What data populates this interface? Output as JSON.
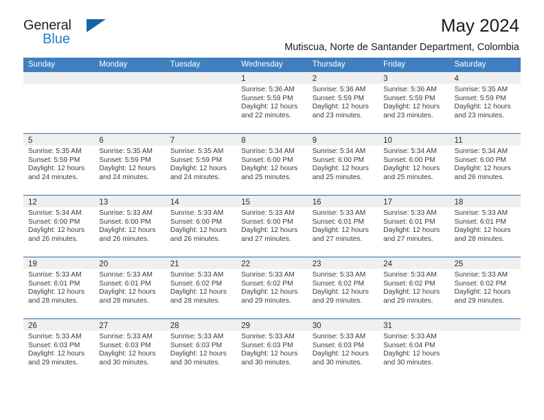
{
  "brand": {
    "name_top": "General",
    "name_bottom": "Blue",
    "accent_color": "#1b7cc2",
    "triangle_color": "#1565a8"
  },
  "header": {
    "title": "May 2024",
    "subtitle": "Mutiscua, Norte de Santander Department, Colombia"
  },
  "calendar": {
    "header_bg": "#3f7fbf",
    "row_divider_color": "#2d6aa8",
    "daynum_band_bg": "#efefef",
    "weekdays": [
      "Sunday",
      "Monday",
      "Tuesday",
      "Wednesday",
      "Thursday",
      "Friday",
      "Saturday"
    ],
    "weeks": [
      [
        {
          "day": "",
          "sunrise": "",
          "sunset": "",
          "daylight_line1": "",
          "daylight_line2": ""
        },
        {
          "day": "",
          "sunrise": "",
          "sunset": "",
          "daylight_line1": "",
          "daylight_line2": ""
        },
        {
          "day": "",
          "sunrise": "",
          "sunset": "",
          "daylight_line1": "",
          "daylight_line2": ""
        },
        {
          "day": "1",
          "sunrise": "Sunrise: 5:36 AM",
          "sunset": "Sunset: 5:59 PM",
          "daylight_line1": "Daylight: 12 hours",
          "daylight_line2": "and 22 minutes."
        },
        {
          "day": "2",
          "sunrise": "Sunrise: 5:36 AM",
          "sunset": "Sunset: 5:59 PM",
          "daylight_line1": "Daylight: 12 hours",
          "daylight_line2": "and 23 minutes."
        },
        {
          "day": "3",
          "sunrise": "Sunrise: 5:36 AM",
          "sunset": "Sunset: 5:59 PM",
          "daylight_line1": "Daylight: 12 hours",
          "daylight_line2": "and 23 minutes."
        },
        {
          "day": "4",
          "sunrise": "Sunrise: 5:35 AM",
          "sunset": "Sunset: 5:59 PM",
          "daylight_line1": "Daylight: 12 hours",
          "daylight_line2": "and 23 minutes."
        }
      ],
      [
        {
          "day": "5",
          "sunrise": "Sunrise: 5:35 AM",
          "sunset": "Sunset: 5:59 PM",
          "daylight_line1": "Daylight: 12 hours",
          "daylight_line2": "and 24 minutes."
        },
        {
          "day": "6",
          "sunrise": "Sunrise: 5:35 AM",
          "sunset": "Sunset: 5:59 PM",
          "daylight_line1": "Daylight: 12 hours",
          "daylight_line2": "and 24 minutes."
        },
        {
          "day": "7",
          "sunrise": "Sunrise: 5:35 AM",
          "sunset": "Sunset: 5:59 PM",
          "daylight_line1": "Daylight: 12 hours",
          "daylight_line2": "and 24 minutes."
        },
        {
          "day": "8",
          "sunrise": "Sunrise: 5:34 AM",
          "sunset": "Sunset: 6:00 PM",
          "daylight_line1": "Daylight: 12 hours",
          "daylight_line2": "and 25 minutes."
        },
        {
          "day": "9",
          "sunrise": "Sunrise: 5:34 AM",
          "sunset": "Sunset: 6:00 PM",
          "daylight_line1": "Daylight: 12 hours",
          "daylight_line2": "and 25 minutes."
        },
        {
          "day": "10",
          "sunrise": "Sunrise: 5:34 AM",
          "sunset": "Sunset: 6:00 PM",
          "daylight_line1": "Daylight: 12 hours",
          "daylight_line2": "and 25 minutes."
        },
        {
          "day": "11",
          "sunrise": "Sunrise: 5:34 AM",
          "sunset": "Sunset: 6:00 PM",
          "daylight_line1": "Daylight: 12 hours",
          "daylight_line2": "and 26 minutes."
        }
      ],
      [
        {
          "day": "12",
          "sunrise": "Sunrise: 5:34 AM",
          "sunset": "Sunset: 6:00 PM",
          "daylight_line1": "Daylight: 12 hours",
          "daylight_line2": "and 26 minutes."
        },
        {
          "day": "13",
          "sunrise": "Sunrise: 5:33 AM",
          "sunset": "Sunset: 6:00 PM",
          "daylight_line1": "Daylight: 12 hours",
          "daylight_line2": "and 26 minutes."
        },
        {
          "day": "14",
          "sunrise": "Sunrise: 5:33 AM",
          "sunset": "Sunset: 6:00 PM",
          "daylight_line1": "Daylight: 12 hours",
          "daylight_line2": "and 26 minutes."
        },
        {
          "day": "15",
          "sunrise": "Sunrise: 5:33 AM",
          "sunset": "Sunset: 6:00 PM",
          "daylight_line1": "Daylight: 12 hours",
          "daylight_line2": "and 27 minutes."
        },
        {
          "day": "16",
          "sunrise": "Sunrise: 5:33 AM",
          "sunset": "Sunset: 6:01 PM",
          "daylight_line1": "Daylight: 12 hours",
          "daylight_line2": "and 27 minutes."
        },
        {
          "day": "17",
          "sunrise": "Sunrise: 5:33 AM",
          "sunset": "Sunset: 6:01 PM",
          "daylight_line1": "Daylight: 12 hours",
          "daylight_line2": "and 27 minutes."
        },
        {
          "day": "18",
          "sunrise": "Sunrise: 5:33 AM",
          "sunset": "Sunset: 6:01 PM",
          "daylight_line1": "Daylight: 12 hours",
          "daylight_line2": "and 28 minutes."
        }
      ],
      [
        {
          "day": "19",
          "sunrise": "Sunrise: 5:33 AM",
          "sunset": "Sunset: 6:01 PM",
          "daylight_line1": "Daylight: 12 hours",
          "daylight_line2": "and 28 minutes."
        },
        {
          "day": "20",
          "sunrise": "Sunrise: 5:33 AM",
          "sunset": "Sunset: 6:01 PM",
          "daylight_line1": "Daylight: 12 hours",
          "daylight_line2": "and 28 minutes."
        },
        {
          "day": "21",
          "sunrise": "Sunrise: 5:33 AM",
          "sunset": "Sunset: 6:02 PM",
          "daylight_line1": "Daylight: 12 hours",
          "daylight_line2": "and 28 minutes."
        },
        {
          "day": "22",
          "sunrise": "Sunrise: 5:33 AM",
          "sunset": "Sunset: 6:02 PM",
          "daylight_line1": "Daylight: 12 hours",
          "daylight_line2": "and 29 minutes."
        },
        {
          "day": "23",
          "sunrise": "Sunrise: 5:33 AM",
          "sunset": "Sunset: 6:02 PM",
          "daylight_line1": "Daylight: 12 hours",
          "daylight_line2": "and 29 minutes."
        },
        {
          "day": "24",
          "sunrise": "Sunrise: 5:33 AM",
          "sunset": "Sunset: 6:02 PM",
          "daylight_line1": "Daylight: 12 hours",
          "daylight_line2": "and 29 minutes."
        },
        {
          "day": "25",
          "sunrise": "Sunrise: 5:33 AM",
          "sunset": "Sunset: 6:02 PM",
          "daylight_line1": "Daylight: 12 hours",
          "daylight_line2": "and 29 minutes."
        }
      ],
      [
        {
          "day": "26",
          "sunrise": "Sunrise: 5:33 AM",
          "sunset": "Sunset: 6:03 PM",
          "daylight_line1": "Daylight: 12 hours",
          "daylight_line2": "and 29 minutes."
        },
        {
          "day": "27",
          "sunrise": "Sunrise: 5:33 AM",
          "sunset": "Sunset: 6:03 PM",
          "daylight_line1": "Daylight: 12 hours",
          "daylight_line2": "and 30 minutes."
        },
        {
          "day": "28",
          "sunrise": "Sunrise: 5:33 AM",
          "sunset": "Sunset: 6:03 PM",
          "daylight_line1": "Daylight: 12 hours",
          "daylight_line2": "and 30 minutes."
        },
        {
          "day": "29",
          "sunrise": "Sunrise: 5:33 AM",
          "sunset": "Sunset: 6:03 PM",
          "daylight_line1": "Daylight: 12 hours",
          "daylight_line2": "and 30 minutes."
        },
        {
          "day": "30",
          "sunrise": "Sunrise: 5:33 AM",
          "sunset": "Sunset: 6:03 PM",
          "daylight_line1": "Daylight: 12 hours",
          "daylight_line2": "and 30 minutes."
        },
        {
          "day": "31",
          "sunrise": "Sunrise: 5:33 AM",
          "sunset": "Sunset: 6:04 PM",
          "daylight_line1": "Daylight: 12 hours",
          "daylight_line2": "and 30 minutes."
        },
        {
          "day": "",
          "sunrise": "",
          "sunset": "",
          "daylight_line1": "",
          "daylight_line2": ""
        }
      ]
    ]
  }
}
